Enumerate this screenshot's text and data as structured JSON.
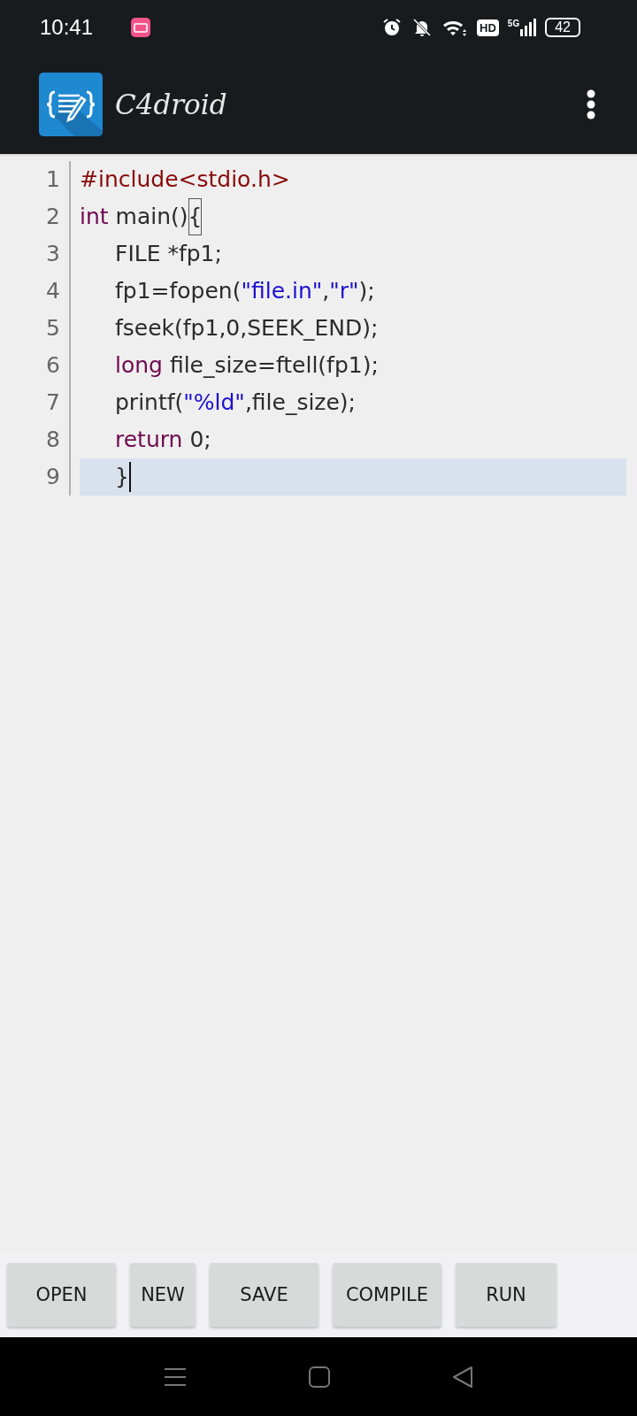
{
  "status_bar": {
    "time": "10:41",
    "hd": "HD",
    "network": "5G",
    "battery": "42"
  },
  "app_bar": {
    "title": "C4droid"
  },
  "editor": {
    "lines": [
      {
        "number": "1",
        "indented": false,
        "current": false,
        "tokens": [
          {
            "kind": "preprocessor",
            "text": "#include<stdio.h>"
          }
        ]
      },
      {
        "number": "2",
        "indented": false,
        "current": false,
        "tokens": [
          {
            "kind": "keyword",
            "text": "int"
          },
          {
            "kind": "plain",
            "text": " main()"
          },
          {
            "kind": "bracket-match",
            "text": "{"
          }
        ]
      },
      {
        "number": "3",
        "indented": true,
        "current": false,
        "tokens": [
          {
            "kind": "plain",
            "text": "FILE *fp1;"
          }
        ]
      },
      {
        "number": "4",
        "indented": true,
        "current": false,
        "tokens": [
          {
            "kind": "plain",
            "text": "fp1=fopen("
          },
          {
            "kind": "string",
            "text": "\"file.in\""
          },
          {
            "kind": "plain",
            "text": ","
          },
          {
            "kind": "string",
            "text": "\"r\""
          },
          {
            "kind": "plain",
            "text": ");"
          }
        ]
      },
      {
        "number": "5",
        "indented": true,
        "current": false,
        "tokens": [
          {
            "kind": "plain",
            "text": "fseek(fp1,0,SEEK_END);"
          }
        ]
      },
      {
        "number": "6",
        "indented": true,
        "current": false,
        "tokens": [
          {
            "kind": "keyword",
            "text": "long"
          },
          {
            "kind": "plain",
            "text": " file_size=ftell(fp1);"
          }
        ]
      },
      {
        "number": "7",
        "indented": true,
        "current": false,
        "tokens": [
          {
            "kind": "plain",
            "text": "printf("
          },
          {
            "kind": "string",
            "text": "\"%ld\""
          },
          {
            "kind": "plain",
            "text": ",file_size);"
          }
        ]
      },
      {
        "number": "8",
        "indented": true,
        "current": false,
        "tokens": [
          {
            "kind": "keyword",
            "text": "return"
          },
          {
            "kind": "plain",
            "text": " 0;"
          }
        ]
      },
      {
        "number": "9",
        "indented": true,
        "current": true,
        "tokens": [
          {
            "kind": "plain",
            "text": "}"
          }
        ]
      }
    ]
  },
  "toolbar": {
    "buttons": [
      "OPEN",
      "NEW",
      "SAVE",
      "COMPILE",
      "RUN"
    ]
  }
}
